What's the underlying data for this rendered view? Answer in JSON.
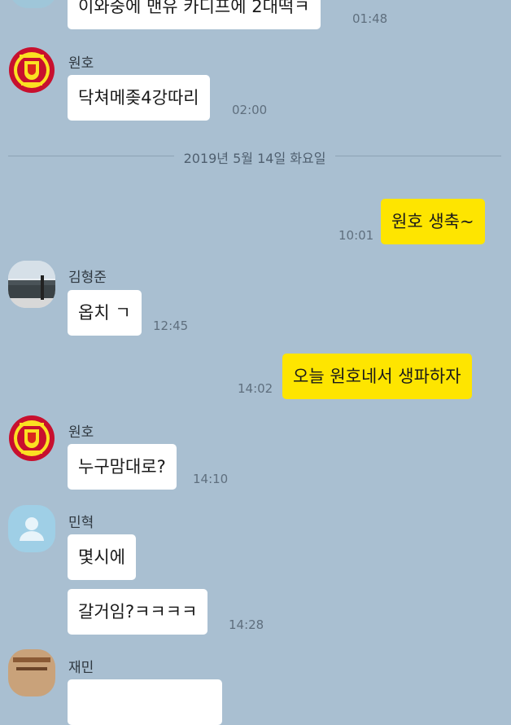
{
  "messages": {
    "m1": {
      "text": "이와중에 맨유 카디프에 2대떡ㅋ",
      "time": "01:48"
    },
    "m2": {
      "sender": "원호",
      "text": "닥쳐메좆4강따리",
      "time": "02:00"
    },
    "date_divider": "2019년 5월 14일 화요일",
    "m3": {
      "text": "원호 생축~",
      "time": "10:01"
    },
    "m4": {
      "sender": "김형준",
      "text": "옵치 ㄱ",
      "time": "12:45"
    },
    "m5": {
      "text": "오늘 원호네서 생파하자",
      "time": "14:02"
    },
    "m6": {
      "sender": "원호",
      "text": "누구맘대로?",
      "time": "14:10"
    },
    "m7": {
      "sender": "민혁",
      "text": "몇시에"
    },
    "m8": {
      "text": "갈거임?ㅋㅋㅋㅋ",
      "time": "14:28"
    },
    "m9": {
      "sender": "재민"
    }
  },
  "colors": {
    "background": "#a9bfd1",
    "my_bubble": "#fee500",
    "other_bubble": "#ffffff"
  },
  "icons": {
    "manutd": "manutd-crest-icon",
    "default_profile": "default-profile-icon"
  }
}
